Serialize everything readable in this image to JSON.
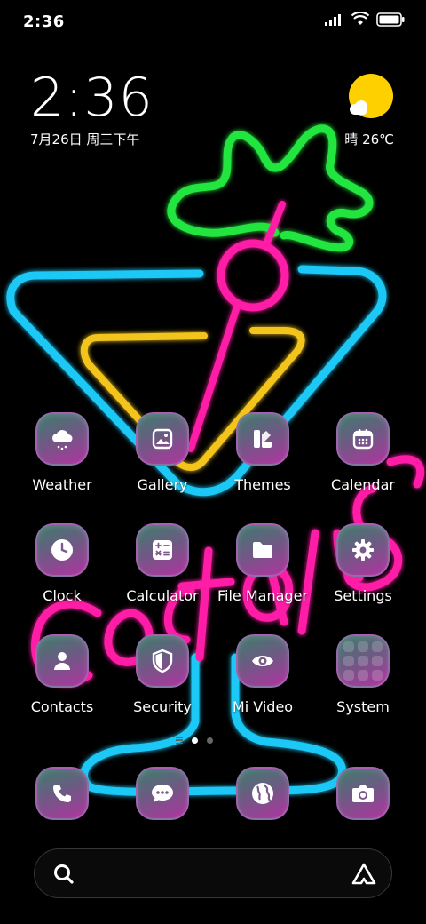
{
  "status_bar": {
    "time": "2:36",
    "icons": [
      "signal-icon",
      "wifi-icon",
      "battery-icon"
    ]
  },
  "clock_widget": {
    "time": "2:36",
    "date": "7月26日 周三下午"
  },
  "weather_widget": {
    "text": "晴 26℃",
    "icon": "sun-cloud-icon"
  },
  "wallpaper": {
    "text": "Coctails",
    "colors": {
      "green": "#22e53f",
      "pink": "#ff1fa6",
      "cyan": "#1fc8f5",
      "yellow": "#f3c51c"
    }
  },
  "apps": [
    {
      "label": "Weather",
      "icon": "weather-icon"
    },
    {
      "label": "Gallery",
      "icon": "gallery-icon"
    },
    {
      "label": "Themes",
      "icon": "themes-icon"
    },
    {
      "label": "Calendar",
      "icon": "calendar-icon"
    },
    {
      "label": "Clock",
      "icon": "clock-icon"
    },
    {
      "label": "Calculator",
      "icon": "calculator-icon"
    },
    {
      "label": "File Manager",
      "icon": "folder-icon"
    },
    {
      "label": "Settings",
      "icon": "gear-icon"
    },
    {
      "label": "Contacts",
      "icon": "person-icon"
    },
    {
      "label": "Security",
      "icon": "shield-icon"
    },
    {
      "label": "Mi Video",
      "icon": "eye-icon"
    },
    {
      "label": "System",
      "icon": "folder-grid-icon"
    }
  ],
  "dock": [
    {
      "icon": "phone-icon"
    },
    {
      "icon": "messages-icon"
    },
    {
      "icon": "browser-icon"
    },
    {
      "icon": "camera-icon"
    }
  ],
  "page_indicator": {
    "pages": 2,
    "active": 1
  },
  "search_bar": {
    "left_icon": "search-icon",
    "right_icon": "assistant-icon"
  },
  "theme": {
    "icon_gradient_start": "#3e7c6c",
    "icon_gradient_end": "#b034a0",
    "background": "#000000"
  }
}
